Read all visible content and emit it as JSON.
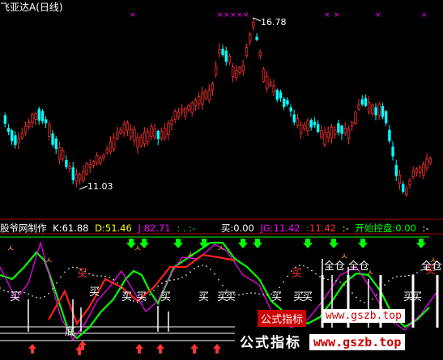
{
  "title": "飞亚达A",
  "period": "(日线)",
  "price": {
    "high_label": "16.78",
    "low_label": "11.03"
  },
  "indicator": {
    "name": "股爷网制作",
    "k": "K:61.88",
    "d": "D:51.46",
    "j": "J:82.71",
    "dots": ":  .  :-",
    "buy": "买:0.00",
    "jg": "JG:11.42",
    "jg2": ":11.42",
    "dots2": ":-",
    "control": "开始控盘:0.00",
    "dots3": ":-"
  },
  "signals": {
    "buy": "买",
    "full": "全仓",
    "bottom": "底"
  },
  "watermark": {
    "a": "公式指标",
    "b": "www.gszb.top",
    "c": "公式指标",
    "d": "www.gszb.top"
  },
  "colors": {
    "up": "#ff3030",
    "down": "#00ffff",
    "magenta": "#ff00ff",
    "green": "#00ff00",
    "orange": "#ff9933"
  }
}
